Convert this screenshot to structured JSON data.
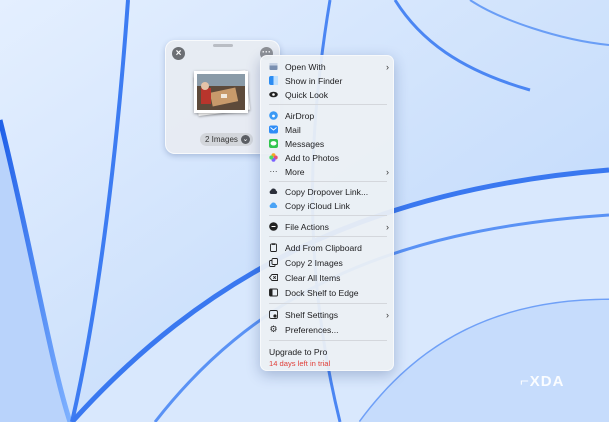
{
  "shelf": {
    "count_label": "2 Images"
  },
  "menu": {
    "items": [
      {
        "label": "Open With",
        "icon": "open-with-icon",
        "submenu": true
      },
      {
        "label": "Show in Finder",
        "icon": "finder-icon",
        "submenu": false
      },
      {
        "label": "Quick Look",
        "icon": "eye-icon",
        "submenu": false
      },
      {
        "label": "AirDrop",
        "icon": "airdrop-icon",
        "submenu": false
      },
      {
        "label": "Mail",
        "icon": "mail-icon",
        "submenu": false
      },
      {
        "label": "Messages",
        "icon": "messages-icon",
        "submenu": false
      },
      {
        "label": "Add to Photos",
        "icon": "photos-icon",
        "submenu": false
      },
      {
        "label": "More",
        "icon": "ellipsis-icon",
        "submenu": true
      },
      {
        "label": "Copy Dropover Link...",
        "icon": "cloud-dark-icon",
        "submenu": false
      },
      {
        "label": "Copy iCloud Link",
        "icon": "icloud-icon",
        "submenu": false
      },
      {
        "label": "File Actions",
        "icon": "file-actions-icon",
        "submenu": true
      },
      {
        "label": "Add From Clipboard",
        "icon": "clipboard-icon",
        "submenu": false
      },
      {
        "label": "Copy 2 Images",
        "icon": "copy-icon",
        "submenu": false
      },
      {
        "label": "Clear All Items",
        "icon": "clear-icon",
        "submenu": false
      },
      {
        "label": "Dock Shelf to Edge",
        "icon": "dock-icon",
        "submenu": false
      },
      {
        "label": "Shelf Settings",
        "icon": "shelf-settings-icon",
        "submenu": true
      },
      {
        "label": "Preferences...",
        "icon": "gear-icon",
        "submenu": false
      }
    ],
    "upgrade_label": "Upgrade to Pro",
    "trial_text": "14 days left in trial"
  },
  "watermark": "XDA",
  "colors": {
    "wallpaper": "#cfe3fb",
    "accent_blue": "#2f6df0",
    "trial_red": "#e0403a"
  }
}
